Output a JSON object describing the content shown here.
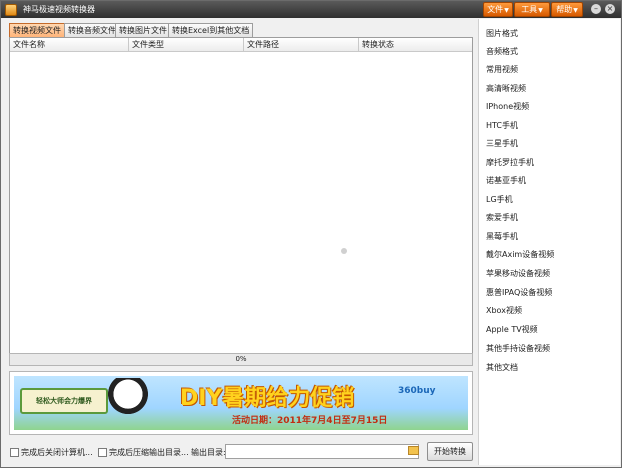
{
  "window": {
    "title": "神马极速视频转换器"
  },
  "menu": {
    "file": "文件",
    "tools": "工具",
    "help": "帮助"
  },
  "tabs": [
    {
      "label": "转换视频文件"
    },
    {
      "label": "转换音频文件"
    },
    {
      "label": "转换图片文件"
    },
    {
      "label": "转换Excel到其他文档"
    }
  ],
  "table": {
    "columns": [
      "文件名称",
      "文件类型",
      "文件路径",
      "转换状态"
    ]
  },
  "progress": {
    "text": "0%",
    "value": 0
  },
  "banner": {
    "sign": "轻松大师会力爆界",
    "title": "DIY暑期给力促销",
    "date": "活动日期：2011年7月4日至7月15日",
    "brand": "360buy"
  },
  "bottom": {
    "shutdown_label": "完成后关闭计算机...",
    "compress_label": "完成后压缩输出目录...",
    "output_label": "输出目录:",
    "start_button": "开始转换"
  },
  "sidebar": {
    "items": [
      "图片格式",
      "音频格式",
      "常用视频",
      "高清晰视频",
      "IPhone视频",
      "HTC手机",
      "三星手机",
      "摩托罗拉手机",
      "诺基亚手机",
      "LG手机",
      "索爱手机",
      "黑莓手机",
      "戴尔Axim设备视频",
      "苹果移动设备视频",
      "惠普IPAQ设备视频",
      "Xbox视频",
      "Apple TV视频",
      "其他手持设备视频",
      "其他文档"
    ]
  }
}
